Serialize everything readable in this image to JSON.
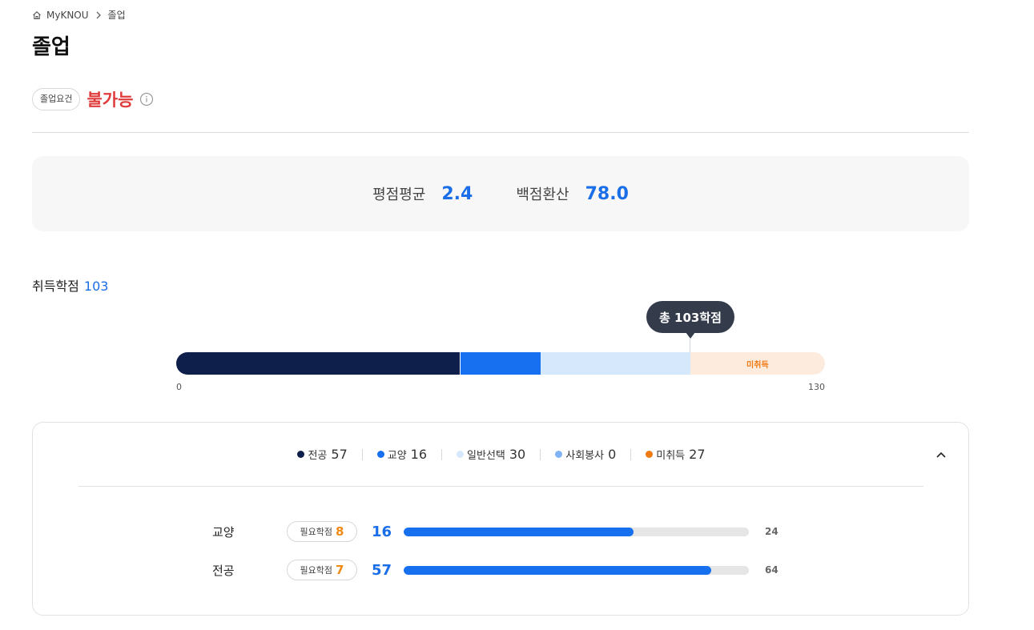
{
  "breadcrumb": {
    "home": "MyKNOU",
    "current": "졸업"
  },
  "page": {
    "title": "졸업"
  },
  "requirement": {
    "badge": "졸업요건",
    "status": "불가능"
  },
  "grades": [
    {
      "label": "평점평균",
      "value": "2.4"
    },
    {
      "label": "백점환산",
      "value": "78.0"
    }
  ],
  "credits": {
    "title": "취득학점",
    "earned_total": "103",
    "tooltip": "총 103학점",
    "axis_min": "0",
    "axis_max": "130",
    "max_value": 130,
    "unearned_label": "미취득",
    "segments": [
      {
        "key": "major",
        "value": 57
      },
      {
        "key": "liberal",
        "value": 16
      },
      {
        "key": "general",
        "value": 30
      },
      {
        "key": "unearned",
        "value": 27
      }
    ]
  },
  "legend": [
    {
      "label": "전공",
      "value": "57",
      "color": "#0f1f4b"
    },
    {
      "label": "교양",
      "value": "16",
      "color": "#1670ef"
    },
    {
      "label": "일반선택",
      "value": "30",
      "color": "#d6e8fb"
    },
    {
      "label": "사회봉사",
      "value": "0",
      "color": "#7fb3f5"
    },
    {
      "label": "미취득",
      "value": "27",
      "color": "#ef7a14"
    }
  ],
  "requirements": [
    {
      "category": "교양",
      "required_label": "필요학점",
      "required": "8",
      "earned": "16",
      "total": "24",
      "fraction": 0.667
    },
    {
      "category": "전공",
      "required_label": "필요학점",
      "required": "7",
      "earned": "57",
      "total": "64",
      "fraction": 0.89
    }
  ],
  "icons": {
    "home": "home-icon",
    "chevron": "chevron-right-icon",
    "info": "info-icon",
    "collapse": "chevron-up-icon"
  }
}
